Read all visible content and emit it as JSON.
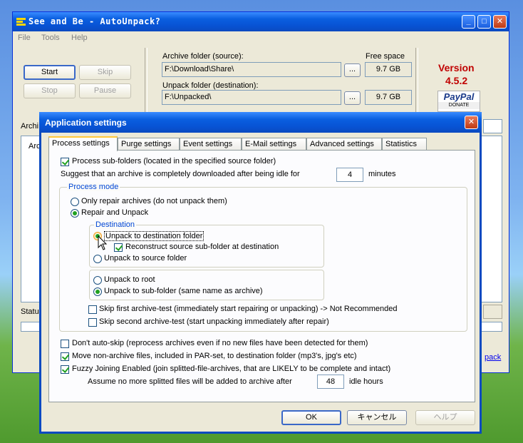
{
  "main": {
    "title": "See and Be - AutoUnpack?",
    "menu": [
      "File",
      "Tools",
      "Help"
    ],
    "buttons": {
      "start": "Start",
      "skip": "Skip",
      "stop": "Stop",
      "pause": "Pause",
      "browse": "..."
    },
    "archive_folder_label": "Archive folder (source):",
    "archive_folder_value": "F:\\Download\\Share\\",
    "unpack_folder_label": "Unpack folder (destination):",
    "unpack_folder_value": "F:\\Unpacked\\",
    "free_space_label": "Free space",
    "free_space_source": "9.7 GB",
    "free_space_dest": "9.7 GB",
    "version_label": "Version",
    "version_number": "4.5.2",
    "paypal_label": "PayPal",
    "paypal_sub": "DONATE",
    "peek_archi": "Archi",
    "peek_arc": "Arc",
    "peek_status": "Statu",
    "peek_link": "pack"
  },
  "dialog": {
    "title": "Application settings",
    "tabs": [
      "Process settings",
      "Purge settings",
      "Event settings",
      "E-Mail settings",
      "Advanced settings",
      "Statistics"
    ],
    "process_subfolders": "Process sub-folders (located in the specified source folder)",
    "idle_suggest": "Suggest that an archive is completely downloaded after being idle for",
    "idle_value": "4",
    "idle_unit": "minutes",
    "process_mode_title": "Process mode",
    "only_repair": "Only repair archives (do not unpack them)",
    "repair_unpack": "Repair and Unpack",
    "destination_title": "Destination",
    "unpack_dest": "Unpack to destination folder",
    "reconstruct": "Reconstruct source sub-folder at destination",
    "unpack_source": "Unpack to source folder",
    "unpack_root": "Unpack to root",
    "unpack_subfolder": "Unpack to sub-folder (same name as archive)",
    "skip_first": "Skip first archive-test (immediately start repairing or unpacking) -> Not Recommended",
    "skip_second": "Skip second archive-test (start unpacking immediately after repair)",
    "dont_autoskip": "Don't auto-skip (reprocess archives even if no new files have been detected for them)",
    "move_nonarchive": "Move non-archive files, included in PAR-set, to destination folder (mp3's, jpg's etc)",
    "fuzzy": "Fuzzy Joining Enabled (join splitted-file-archives, that are LIKELY to be complete and intact)",
    "assume_text": "Assume no more splitted files will be added to archive after",
    "assume_value": "48",
    "assume_unit": "idle hours",
    "ok": "OK",
    "cancel": "キャンセル",
    "help": "ヘルプ"
  }
}
